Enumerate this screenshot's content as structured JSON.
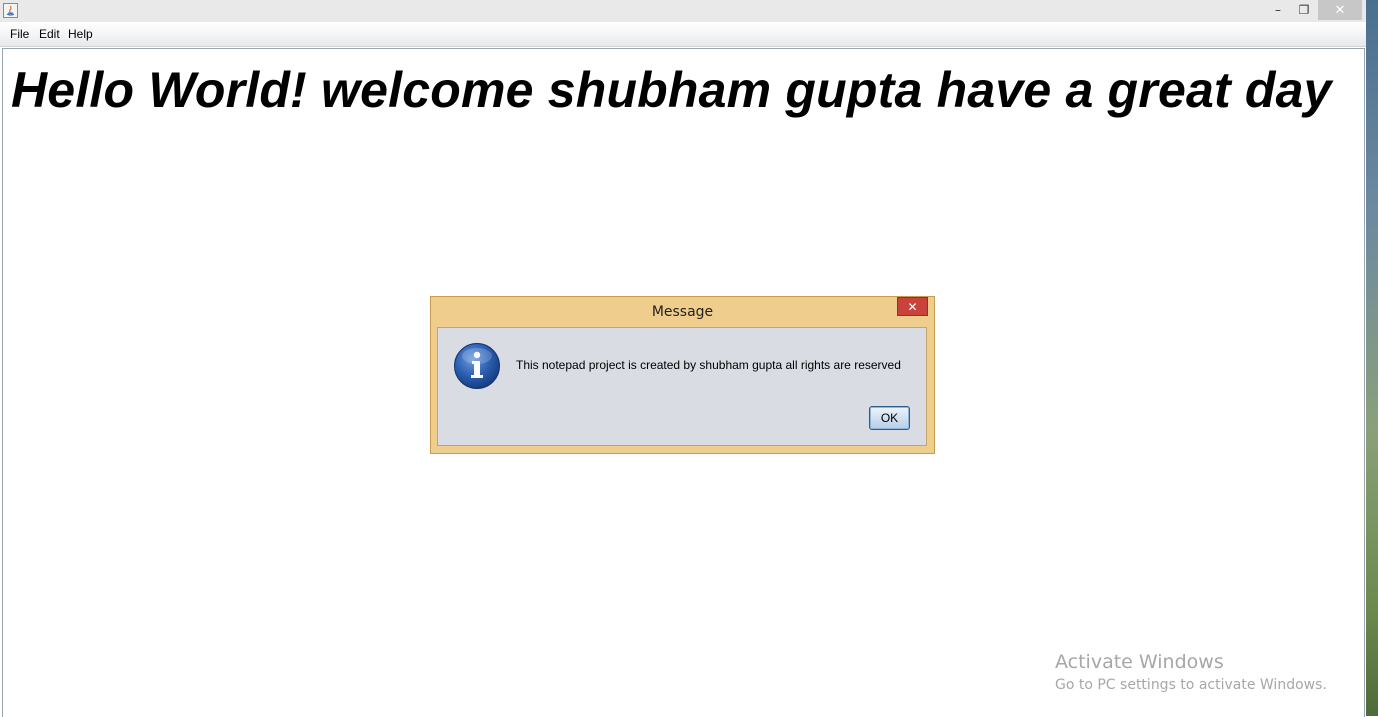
{
  "window": {
    "minimize_glyph": "–",
    "maximize_glyph": "❐",
    "close_glyph": "✕"
  },
  "menu": {
    "items": [
      {
        "label": "File"
      },
      {
        "label": "Edit"
      },
      {
        "label": "Help"
      }
    ]
  },
  "editor": {
    "content": "Hello World! welcome shubham gupta have a great day"
  },
  "dialog": {
    "title": "Message",
    "close_glyph": "✕",
    "message": "This notepad project is created by shubham gupta all rights are reserved",
    "ok_label": "OK",
    "icon": "info-icon"
  },
  "watermark": {
    "title": "Activate Windows",
    "subtitle": "Go to PC settings to activate Windows."
  },
  "colors": {
    "dialog_frame": "#efcd8c",
    "dialog_body": "#d9dce3",
    "close_red": "#c9423c",
    "info_blue": "#2a5db0"
  }
}
